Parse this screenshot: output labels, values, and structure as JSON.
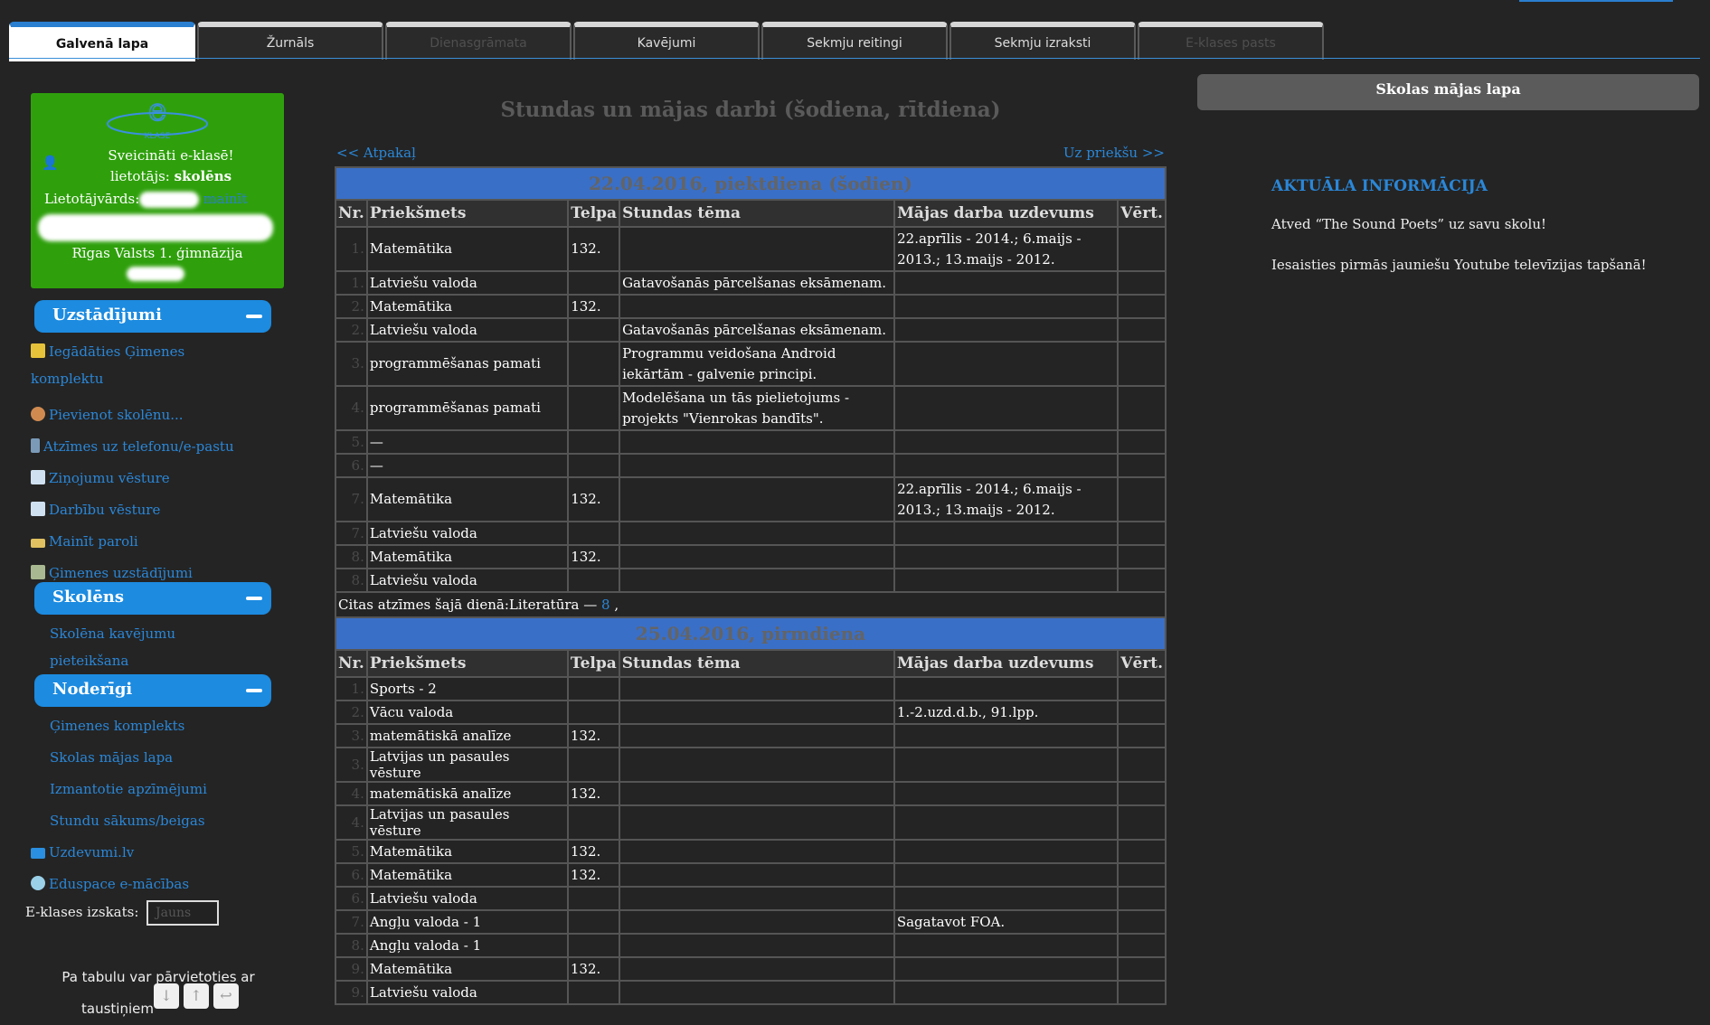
{
  "tabs": [
    {
      "label": "Galvenā lapa",
      "state": "active"
    },
    {
      "label": "Žurnāls",
      "state": "normal"
    },
    {
      "label": "Dienasgrāmata",
      "state": "disabled"
    },
    {
      "label": "Kavējumi",
      "state": "normal"
    },
    {
      "label": "Sekmju reitingi",
      "state": "normal"
    },
    {
      "label": "Sekmju izraksti",
      "state": "normal"
    },
    {
      "label": "E-klases pasts",
      "state": "disabled"
    }
  ],
  "greeting": {
    "welcome": "Sveicināti e-klasē!",
    "role_prefix": "lietotājs:",
    "role": "skolēns",
    "username_label": "Lietotājvārds:",
    "change_link": "mainīt",
    "school": "Rīgas Valsts 1. ģimnāzija"
  },
  "sidebar": {
    "settings_title": "Uzstādījumi",
    "settings_links": [
      {
        "label": "Iegādāties Ģimenes komplektu",
        "icon": "thumbs-up-icon"
      },
      {
        "label": "Pievienot skolēnu...",
        "icon": "add-user-icon"
      },
      {
        "label": "Atzīmes uz telefonu/e-pastu",
        "icon": "phone-icon"
      },
      {
        "label": "Ziņojumu vēsture",
        "icon": "document-icon"
      },
      {
        "label": "Darbību vēsture",
        "icon": "document-icon"
      },
      {
        "label": "Mainīt paroli",
        "icon": "password-icon"
      },
      {
        "label": "Ģimenes uzstādījumi",
        "icon": "family-settings-icon"
      }
    ],
    "student_title": "Skolēns",
    "student_links": [
      {
        "label": "Skolēna kavējumu pieteikšana"
      }
    ],
    "useful_title": "Noderīgi",
    "useful_links": [
      {
        "label": "Ģimenes komplekts"
      },
      {
        "label": "Skolas mājas lapa"
      },
      {
        "label": "Izmantotie apzīmējumi"
      },
      {
        "label": "Stundu sākums/beigas"
      }
    ],
    "extra_links": [
      {
        "label": "Uzdevumi.lv",
        "icon": "folder-icon"
      },
      {
        "label": "Eduspace e-mācības",
        "icon": "disc-icon"
      }
    ],
    "theme_label": "E-klases izskats:",
    "theme_value": "Jauns",
    "keyboard_hint_line1": "Pa tabulu var pārvietoties ar",
    "keyboard_hint_line2": "taustiņiem"
  },
  "main": {
    "title": "Stundas un mājas darbi (šodiena, rītdiena)",
    "back_link": "<< Atpakaļ",
    "forward_link": "Uz priekšu >>",
    "columns": [
      "Nr.",
      "Priekšmets",
      "Telpa",
      "Stundas tēma",
      "Mājas darba uzdevums",
      "Vērt."
    ],
    "days": [
      {
        "heading": "22.04.2016, piektdiena (šodien)",
        "rows": [
          {
            "nr": "1.",
            "subject": "Matemātika",
            "room": "132.",
            "topic": "",
            "homework": "22.aprīlis - 2014.; 6.maijs - 2013.; 13.maijs - 2012.",
            "grade": "",
            "tall": true
          },
          {
            "nr": "1.",
            "subject": "Latviešu valoda",
            "room": "",
            "topic": "Gatavošanās pārcelšanas eksāmenam.",
            "homework": "",
            "grade": "",
            "tall": false
          },
          {
            "nr": "2.",
            "subject": "Matemātika",
            "room": "132.",
            "topic": "",
            "homework": "",
            "grade": "",
            "tall": false
          },
          {
            "nr": "2.",
            "subject": "Latviešu valoda",
            "room": "",
            "topic": "Gatavošanās pārcelšanas eksāmenam.",
            "homework": "",
            "grade": "",
            "tall": false
          },
          {
            "nr": "3.",
            "subject": "programmēšanas pamati",
            "room": "",
            "topic": "Programmu veidošana Android iekārtām - galvenie principi.",
            "homework": "",
            "grade": "",
            "tall": true
          },
          {
            "nr": "4.",
            "subject": "programmēšanas pamati",
            "room": "",
            "topic": "Modelēšana un tās pielietojums - projekts \"Vienrokas bandīts\".",
            "homework": "",
            "grade": "",
            "tall": true
          },
          {
            "nr": "5.",
            "subject": "—",
            "room": "",
            "topic": "",
            "homework": "",
            "grade": "",
            "tall": false
          },
          {
            "nr": "6.",
            "subject": "—",
            "room": "",
            "topic": "",
            "homework": "",
            "grade": "",
            "tall": false
          },
          {
            "nr": "7.",
            "subject": "Matemātika",
            "room": "132.",
            "topic": "",
            "homework": "22.aprīlis - 2014.; 6.maijs - 2013.; 13.maijs - 2012.",
            "grade": "",
            "tall": true
          },
          {
            "nr": "7.",
            "subject": "Latviešu valoda",
            "room": "",
            "topic": "",
            "homework": "",
            "grade": "",
            "tall": false
          },
          {
            "nr": "8.",
            "subject": "Matemātika",
            "room": "132.",
            "topic": "",
            "homework": "",
            "grade": "",
            "tall": false
          },
          {
            "nr": "8.",
            "subject": "Latviešu valoda",
            "room": "",
            "topic": "",
            "homework": "",
            "grade": "",
            "tall": false
          }
        ],
        "other_prefix": "Citas atzīmes šajā dienā:Literatūra — ",
        "other_grade": "8",
        "other_suffix": " ,"
      },
      {
        "heading": "25.04.2016, pirmdiena",
        "rows": [
          {
            "nr": "1.",
            "subject": "Sports - 2",
            "room": "",
            "topic": "",
            "homework": "",
            "grade": "",
            "tall": false
          },
          {
            "nr": "2.",
            "subject": "Vācu valoda",
            "room": "",
            "topic": "",
            "homework": "1.-2.uzd.d.b., 91.lpp.",
            "grade": "",
            "tall": false
          },
          {
            "nr": "3.",
            "subject": "matemātiskā analīze",
            "room": "132.",
            "topic": "",
            "homework": "",
            "grade": "",
            "tall": false
          },
          {
            "nr": "3.",
            "subject": "Latvijas un pasaules vēsture",
            "room": "",
            "topic": "",
            "homework": "",
            "grade": "",
            "tall": false
          },
          {
            "nr": "4.",
            "subject": "matemātiskā analīze",
            "room": "132.",
            "topic": "",
            "homework": "",
            "grade": "",
            "tall": false
          },
          {
            "nr": "4.",
            "subject": "Latvijas un pasaules vēsture",
            "room": "",
            "topic": "",
            "homework": "",
            "grade": "",
            "tall": false
          },
          {
            "nr": "5.",
            "subject": "Matemātika",
            "room": "132.",
            "topic": "",
            "homework": "",
            "grade": "",
            "tall": false
          },
          {
            "nr": "6.",
            "subject": "Matemātika",
            "room": "132.",
            "topic": "",
            "homework": "",
            "grade": "",
            "tall": false
          },
          {
            "nr": "6.",
            "subject": "Latviešu valoda",
            "room": "",
            "topic": "",
            "homework": "",
            "grade": "",
            "tall": false
          },
          {
            "nr": "7.",
            "subject": "Angļu valoda - 1",
            "room": "",
            "topic": "",
            "homework": "Sagatavot FOA.",
            "grade": "",
            "tall": false
          },
          {
            "nr": "8.",
            "subject": "Angļu valoda - 1",
            "room": "",
            "topic": "",
            "homework": "",
            "grade": "",
            "tall": false
          },
          {
            "nr": "9.",
            "subject": "Matemātika",
            "room": "132.",
            "topic": "",
            "homework": "",
            "grade": "",
            "tall": false
          },
          {
            "nr": "9.",
            "subject": "Latviešu valoda",
            "room": "",
            "topic": "",
            "homework": "",
            "grade": "",
            "tall": false
          }
        ]
      }
    ]
  },
  "right": {
    "home_button": "Skolas mājas lapa",
    "news_title": "AKTUĀLA INFORMĀCIJA",
    "news": [
      "Atved “The Sound Poets” uz savu skolu!",
      "Iesaisties pirmās jauniešu Youtube televīzijas tapšanā!"
    ]
  },
  "colors": {
    "accent": "#1c8be0",
    "greeting_bg": "#2fa00c",
    "day_header": "#3a6fc7",
    "background": "#242424"
  }
}
